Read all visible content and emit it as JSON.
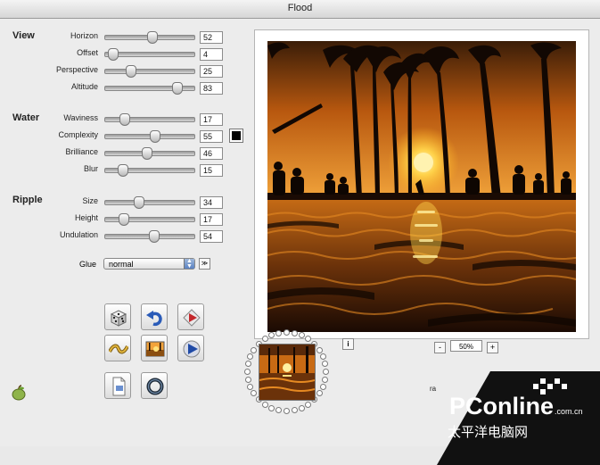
{
  "window": {
    "title": "Flood"
  },
  "sections": {
    "view": "View",
    "water": "Water",
    "ripple": "Ripple"
  },
  "sliders": [
    {
      "id": "horizon",
      "label": "Horizon",
      "value": "52"
    },
    {
      "id": "offset",
      "label": "Offset",
      "value": "4"
    },
    {
      "id": "perspective",
      "label": "Perspective",
      "value": "25"
    },
    {
      "id": "altitude",
      "label": "Altitude",
      "value": "83"
    },
    {
      "id": "waviness",
      "label": "Waviness",
      "value": "17"
    },
    {
      "id": "complexity",
      "label": "Complexity",
      "value": "55"
    },
    {
      "id": "brilliance",
      "label": "Brilliance",
      "value": "46"
    },
    {
      "id": "blur",
      "label": "Blur",
      "value": "15"
    },
    {
      "id": "size",
      "label": "Size",
      "value": "34"
    },
    {
      "id": "height",
      "label": "Height",
      "value": "17"
    },
    {
      "id": "undulation",
      "label": "Undulation",
      "value": "54"
    }
  ],
  "slider_levels": [
    0.52,
    0.08,
    0.28,
    0.8,
    0.21,
    0.55,
    0.46,
    0.19,
    0.37,
    0.2,
    0.54
  ],
  "glue": {
    "label": "Glue",
    "value": "normal",
    "button": "≫"
  },
  "water_color": "#000000",
  "zoom": {
    "minus": "-",
    "value": "50%",
    "plus": "+"
  },
  "info_button": "i",
  "tools": [
    "dice-icon",
    "undo-icon",
    "render-icon",
    "wave-icon",
    "landscape-icon",
    "play-icon",
    "file-icon",
    "ring-icon"
  ],
  "footer": {
    "ra": "ra"
  },
  "watermark": {
    "brand": "PConline",
    "domain": ".com.cn",
    "cn": "太平洋电脑网"
  }
}
